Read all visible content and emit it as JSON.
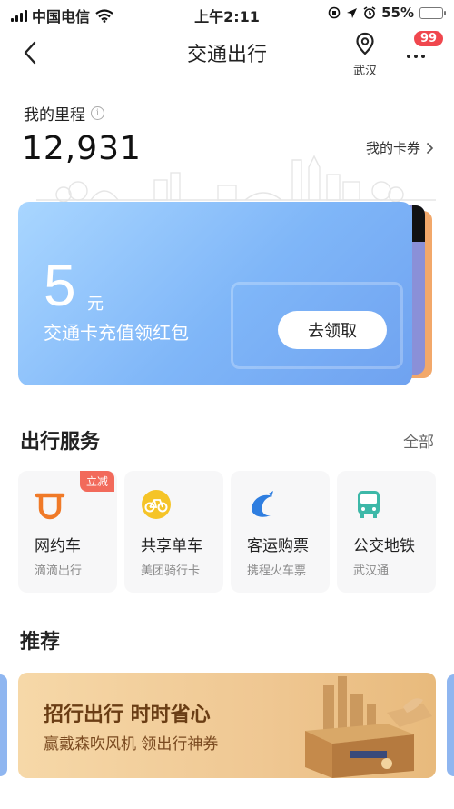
{
  "status_bar": {
    "carrier": "中国电信",
    "time": "上午2:11",
    "battery": "55%",
    "battery_level": 0.55
  },
  "header": {
    "title": "交通出行",
    "location": "武汉",
    "badge": "99"
  },
  "mileage": {
    "label": "我的里程",
    "info_icon": "i",
    "value": "12,931",
    "coupon_link": "我的卡券"
  },
  "banner": {
    "amount": "5",
    "unit": "元",
    "description": "交通卡充值领红包",
    "cta": "去领取"
  },
  "services": {
    "title": "出行服务",
    "all_link": "全部",
    "items": [
      {
        "name": "网约车",
        "sub": "滴滴出行",
        "tag": "立减",
        "icon": "didi-icon",
        "color": "#f07a28"
      },
      {
        "name": "共享单车",
        "sub": "美团骑行卡",
        "icon": "bike-icon",
        "color": "#f5c428"
      },
      {
        "name": "客运购票",
        "sub": "携程火车票",
        "icon": "dolphin-icon",
        "color": "#2f7ee0"
      },
      {
        "name": "公交地铁",
        "sub": "武汉通",
        "icon": "bus-icon",
        "color": "#3db8a8"
      }
    ]
  },
  "recommend": {
    "title": "推荐",
    "promo_title": "招行出行 时时省心",
    "promo_sub": "赢戴森吹风机 领出行神券"
  },
  "colors": {
    "accent_red": "#f0474e",
    "card_blue": "#7fb6f8",
    "promo_gold": "#efc792"
  }
}
